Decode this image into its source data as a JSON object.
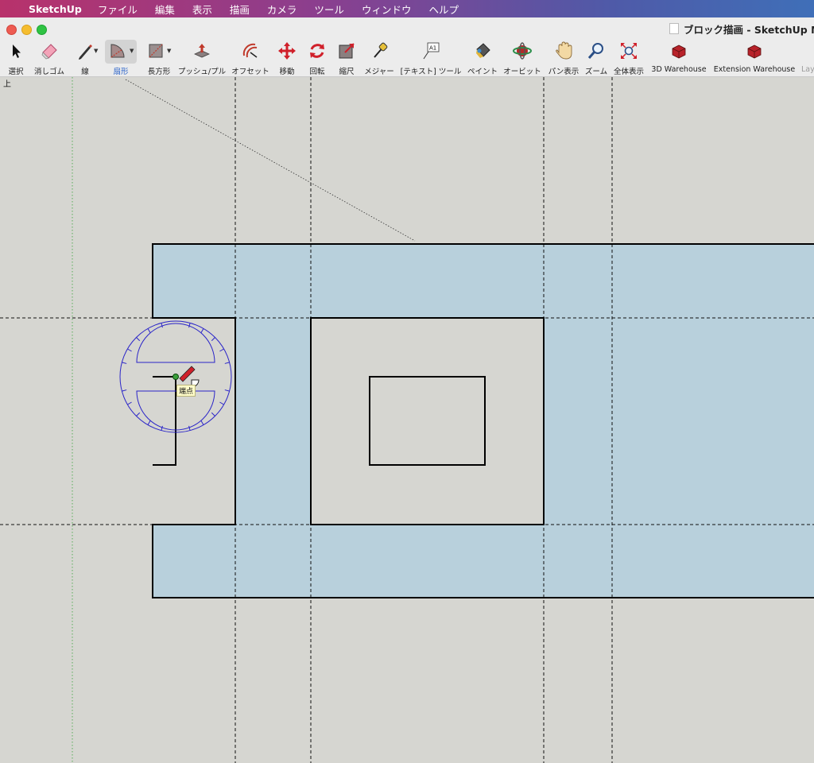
{
  "menubar": {
    "app_name": "SketchUp",
    "items": [
      "ファイル",
      "編集",
      "表示",
      "描画",
      "カメラ",
      "ツール",
      "ウィンドウ",
      "ヘルプ"
    ]
  },
  "window": {
    "title": "ブロック描画 - SketchUp Mak"
  },
  "toolbar": {
    "tools": [
      {
        "label": "選択",
        "icon": "select-arrow-icon"
      },
      {
        "label": "消しゴム",
        "icon": "eraser-icon"
      },
      {
        "label": "線",
        "icon": "pencil-icon"
      },
      {
        "label": "扇形",
        "icon": "pie-arc-icon",
        "active": true
      },
      {
        "label": "長方形",
        "icon": "rectangle-icon"
      },
      {
        "label": "プッシュ/プル",
        "icon": "push-pull-icon"
      },
      {
        "label": "オフセット",
        "icon": "offset-icon"
      },
      {
        "label": "移動",
        "icon": "move-icon"
      },
      {
        "label": "回転",
        "icon": "rotate-icon"
      },
      {
        "label": "縮尺",
        "icon": "scale-icon"
      },
      {
        "label": "メジャー",
        "icon": "tape-measure-icon"
      },
      {
        "label": "[テキスト] ツール",
        "icon": "text-tool-icon"
      },
      {
        "label": "ペイント",
        "icon": "paint-bucket-icon"
      },
      {
        "label": "オービット",
        "icon": "orbit-icon"
      },
      {
        "label": "パン表示",
        "icon": "pan-hand-icon"
      },
      {
        "label": "ズーム",
        "icon": "zoom-icon"
      },
      {
        "label": "全体表示",
        "icon": "zoom-extents-icon"
      },
      {
        "label": "3D Warehouse",
        "icon": "3d-warehouse-icon"
      },
      {
        "label": "Extension Warehouse",
        "icon": "extension-warehouse-icon"
      },
      {
        "label": "Lay",
        "icon": "layout-icon"
      }
    ]
  },
  "viewport": {
    "view_name": "上",
    "inference_tooltip": "端点",
    "colors": {
      "background": "#d6d6d1",
      "face_fill": "#b8d0dc",
      "edge": "#000000",
      "protractor": "#2a24c8",
      "axis_green": "#4aa84a"
    }
  }
}
